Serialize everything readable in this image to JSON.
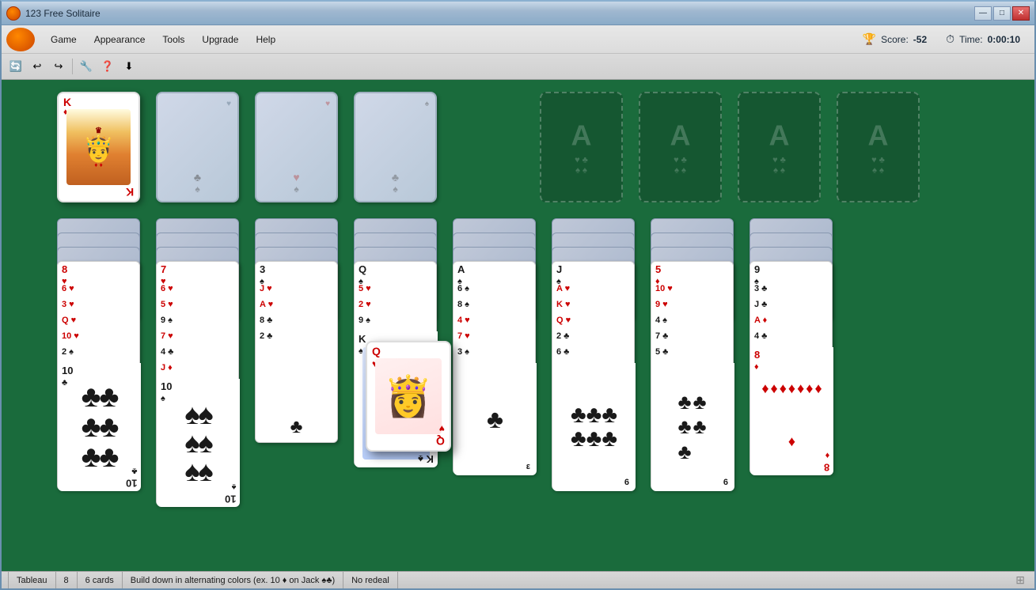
{
  "window": {
    "title": "123 Free Solitaire",
    "controls": {
      "minimize": "—",
      "maximize": "□",
      "close": "✕"
    }
  },
  "toolbar": {
    "icons": [
      "🔄",
      "↩",
      "↪",
      "🔧",
      "❓",
      "⬇"
    ]
  },
  "menubar": {
    "items": [
      "Game",
      "Appearance",
      "Tools",
      "Upgrade",
      "Help"
    ]
  },
  "header": {
    "score_label": "Score:",
    "score_value": "-52",
    "time_label": "Time:",
    "time_value": "0:00:10"
  },
  "status_bar": {
    "game_type": "Tableau",
    "columns": "8",
    "cards": "6 cards",
    "rule": "Build down in alternating colors (ex. 10 ♦ on Jack ♠♣)",
    "redeal": "No redeal"
  },
  "colors": {
    "felt": "#1a6b3c",
    "card_bg": "#ffffff",
    "card_red": "#cc0000",
    "card_black": "#1a1a1a",
    "foundation_ghost": "rgba(255,255,255,0.2)"
  }
}
